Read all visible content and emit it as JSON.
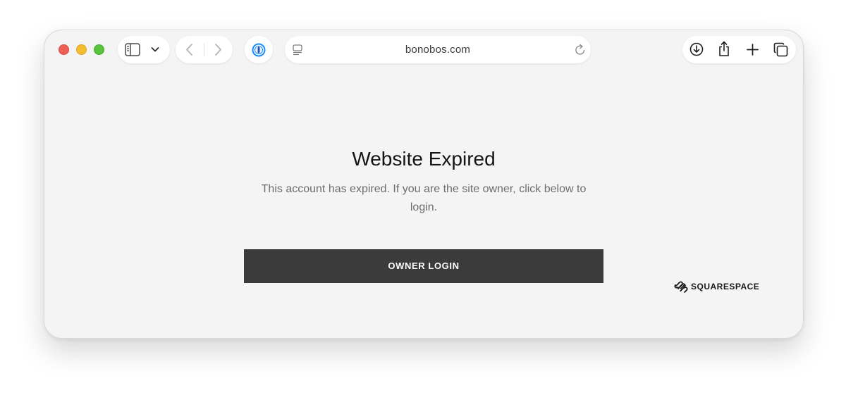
{
  "browser": {
    "url": "bonobos.com",
    "icons": {
      "sidebar": "sidebar-icon",
      "chevron": "chevron-down-icon",
      "back": "back-arrow-icon",
      "forward": "forward-arrow-icon",
      "password_manager": "onepassword-icon",
      "reader": "reader-view-icon",
      "reload": "reload-icon",
      "download": "download-icon",
      "share": "share-icon",
      "new_tab": "plus-icon",
      "tabs": "tab-overview-icon"
    }
  },
  "page": {
    "title": "Website Expired",
    "message": "This account has expired. If you are the site owner, click below to login.",
    "login_button": "OWNER LOGIN",
    "brand": "SQUARESPACE"
  },
  "colors": {
    "page_background": "#f4f4f4",
    "button_background": "#3b3b3b",
    "button_text": "#ffffff",
    "message_text": "#6d6d6d",
    "onepassword_blue": "#1a8cff"
  }
}
